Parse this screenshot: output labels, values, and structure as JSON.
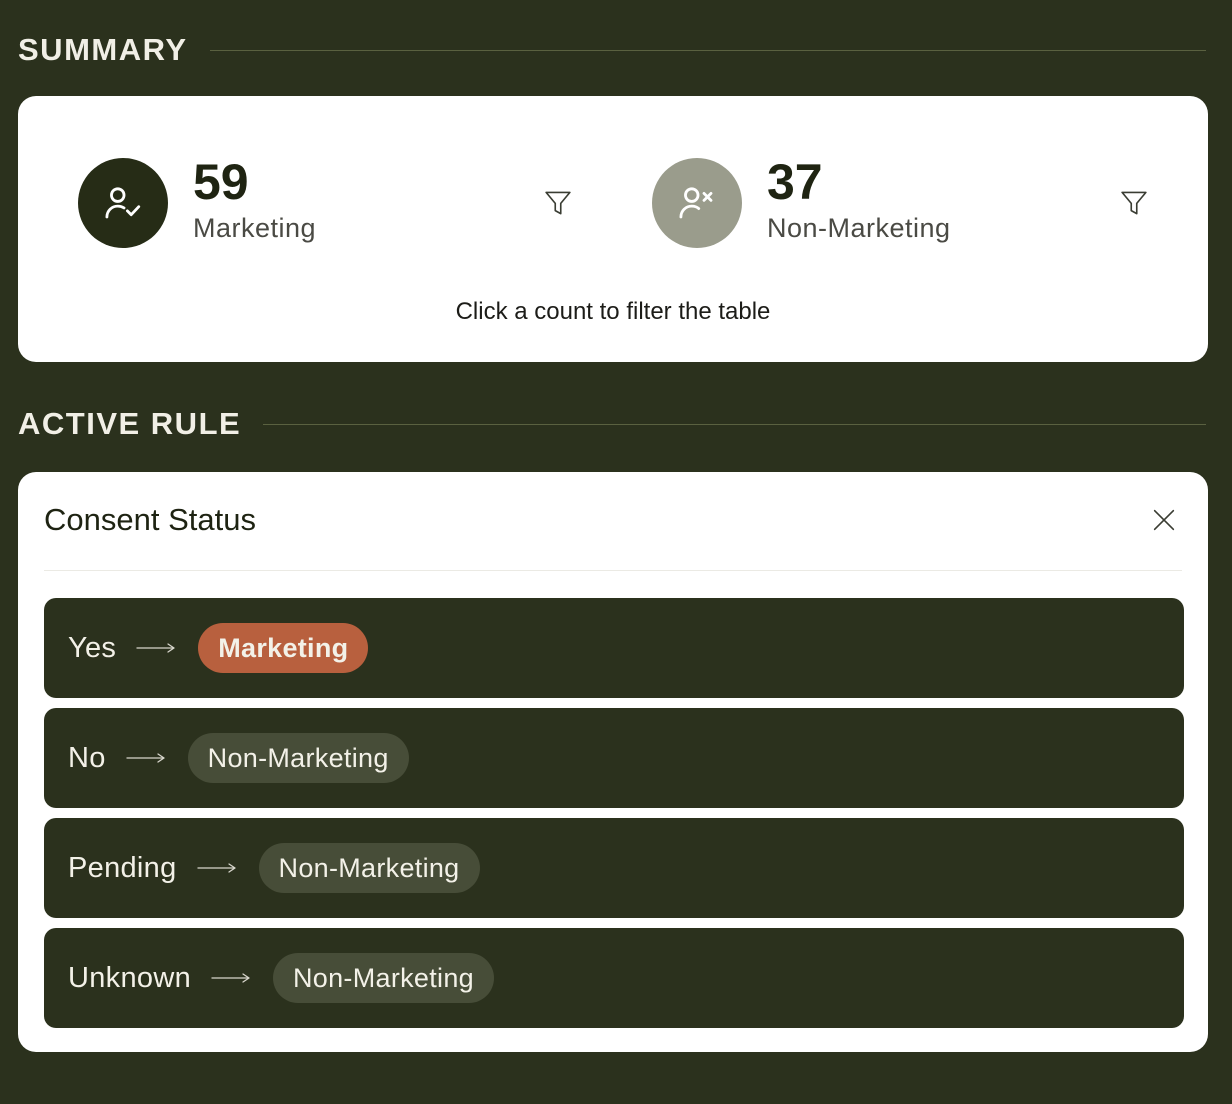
{
  "summary": {
    "header": "SUMMARY",
    "marketing": {
      "count": "59",
      "label": "Marketing"
    },
    "non_marketing": {
      "count": "37",
      "label": "Non-Marketing"
    },
    "hint": "Click a count to filter the table"
  },
  "active_rule": {
    "header": "ACTIVE RULE",
    "title": "Consent Status",
    "mappings": [
      {
        "key": "Yes",
        "value": "Marketing",
        "type": "marketing"
      },
      {
        "key": "No",
        "value": "Non-Marketing",
        "type": "non-marketing"
      },
      {
        "key": "Pending",
        "value": "Non-Marketing",
        "type": "non-marketing"
      },
      {
        "key": "Unknown",
        "value": "Non-Marketing",
        "type": "non-marketing"
      }
    ]
  },
  "icons": {
    "marketing": "user-check-icon",
    "non_marketing": "user-x-icon",
    "filter": "filter-icon",
    "close": "close-icon",
    "arrow": "arrow-right-icon"
  },
  "colors": {
    "background": "#2b311d",
    "marketing_accent": "#b8603e",
    "non_marketing_pill": "#474d38",
    "marketing_avatar": "#262c16",
    "non_marketing_avatar": "#9a9c8c"
  }
}
